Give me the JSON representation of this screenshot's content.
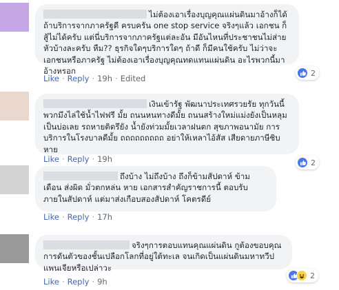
{
  "comments": [
    {
      "avatar_color": "#c6a7e6",
      "text": "ไม่ต้องเอาเรื่องบุญคุณแผ่นดินมาอ้างก็ได้ ถ้าบริการจากภาครัฐดี ครบครัน one stop service จริงๆแล้ว เอกชน ก็สู้ไม่ได้ครับ แต่นี่บริการจากภาครัฐแต่ละอัน มีอันไหนที่ประชาชนไม่ส่ายหัวบ้างละครับ หืม?? ธุรกิจใดๆบริการใดๆ ถ้าดี ก็มีคนใช้ครับ ไม่ว่าจะเอกชนหรือภาครัฐ ไม่ต้องเอาเรื่องบุญคุณทดแทนแผ่นดิน อะไรพวกนี้มาอ้างหรอก",
      "like_label": "Like",
      "reply_label": "Reply",
      "time": "19h",
      "edited_label": "Edited",
      "reaction_count": "2"
    },
    {
      "avatar_color": "#ead8cf",
      "text": "เงินเข้ารัฐ พัฒนาประเทศรวยรัย ทุกวันนี้ พวกมึงไล่ใช้น้ำไฟฟรี มั้ย ถนนหนทางดีมั้ย ถนนสร้างใหม่แม่งยังเป็นหลุมเป็นบ่อเลย รถหายติดรึยัง น้ำยังท่วมมั้ยเวลาฝนตก สุขภาพอนามัย การบริการในโรงบาลดีมั้ย ถถถถถถถถถ อย่าให้เหลาไอ้สัส เสียดายภาษีชิบหาย",
      "like_label": "Like",
      "reply_label": "Reply",
      "time": "19h",
      "reaction_count": "2"
    },
    {
      "avatar_color": "#d3d3d3",
      "text": "ถึงบ้าง ไม่ถึงบ้าง ถึงก็ข้ามสัปดาห์ ข้ามเดือน ส่งผิด มั่วตกหล่น หาย เอกสารสำคัญราชการนี้ ตอบรับภายในสัปดาห์ แต่มาส่งเกือบสองสัปดาห์ โคตรดีย์",
      "like_label": "Like",
      "reply_label": "Reply",
      "time": "17h"
    },
    {
      "avatar_color": "#9a9a9a",
      "text": "จริงๆการตอบแทนคุณแผ่นดิน กูต้องขอบคุณการดันตัวของชั้นเปลือกโลกที่อยู่ใต้ทะเล จนเกิดเป็นแผ่นดินมหาทวีปแพนเจียหรือเปล่าวะ",
      "like_label": "Like",
      "reply_label": "Reply",
      "time": "9h",
      "reaction_count": "2"
    }
  ],
  "colors": {
    "bubble": "#f2f3f5",
    "link": "#4267b2",
    "meta": "#606770",
    "like_blue": "#4a76e8",
    "haha_yellow": "#f7d24a"
  },
  "icons": [
    "like-icon",
    "haha-icon"
  ]
}
